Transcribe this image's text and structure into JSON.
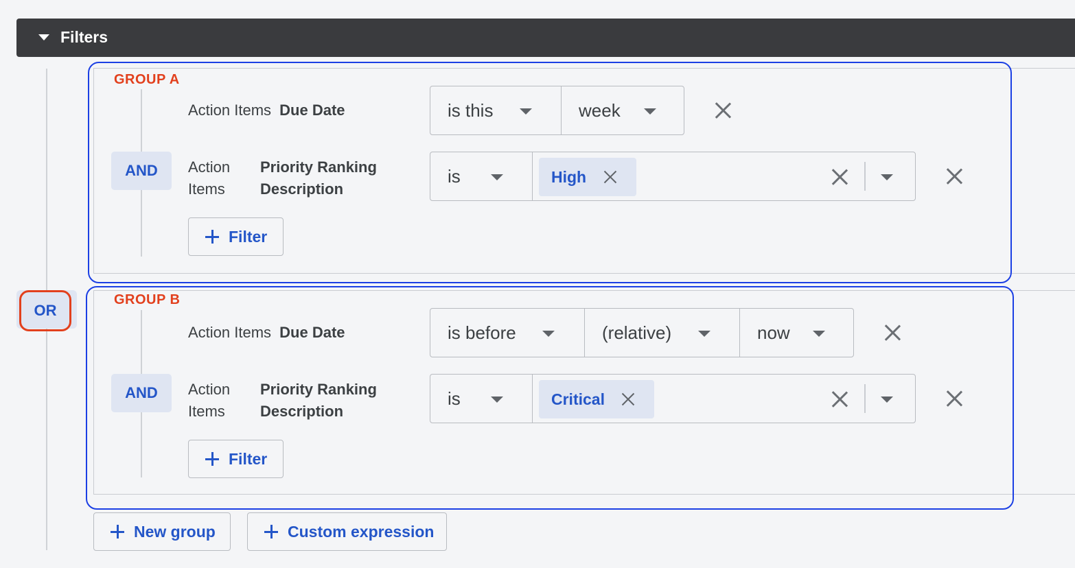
{
  "header": {
    "title": "Filters"
  },
  "or_label": "OR",
  "groups": [
    {
      "label": "GROUP A",
      "row1": {
        "entity": "Action Items",
        "field": "Due Date",
        "op": "is this",
        "value": "week"
      },
      "row2": {
        "conjunction": "AND",
        "entity": "Action Items",
        "field": "Priority Ranking Description",
        "op": "is",
        "tag": "High"
      },
      "add_filter": "Filter"
    },
    {
      "label": "GROUP B",
      "row1": {
        "entity": "Action Items",
        "field": "Due Date",
        "op": "is before",
        "mode": "(relative)",
        "value": "now"
      },
      "row2": {
        "conjunction": "AND",
        "entity": "Action Items",
        "field": "Priority Ranking Description",
        "op": "is",
        "tag": "Critical"
      },
      "add_filter": "Filter"
    }
  ],
  "footer": {
    "new_group": "New group",
    "custom_expression": "Custom expression"
  },
  "colors": {
    "header_bg": "#3a3b3e",
    "accent_blue": "#2456c8",
    "group_label": "#e2401d",
    "highlight_outline": "#1b3fe4"
  }
}
